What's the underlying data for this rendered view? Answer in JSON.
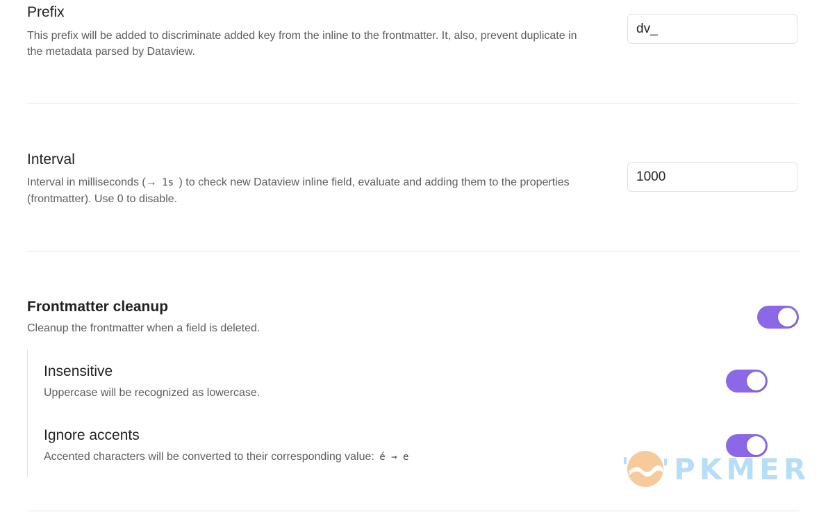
{
  "prefix": {
    "name": "Prefix",
    "description": "This prefix will be added to discriminate added key from the inline to the frontmatter. It, also, prevent duplicate in the metadata parsed by Dataview.",
    "value": "dv_"
  },
  "interval": {
    "name": "Interval",
    "description_before": "Interval in milliseconds (→",
    "description_code": "1s",
    "description_after": ") to check new Dataview inline field, evaluate and adding them to the properties (frontmatter). Use 0 to disable.",
    "value": "1000"
  },
  "frontmatter_cleanup": {
    "name": "Frontmatter cleanup",
    "description": "Cleanup the frontmatter when a field is deleted.",
    "enabled": true
  },
  "insensitive": {
    "name": "Insensitive",
    "description": "Uppercase will be recognized as lowercase.",
    "enabled": true
  },
  "ignore_accents": {
    "name": "Ignore accents",
    "description": "Accented characters will be converted to their corresponding value:",
    "example_code": "é → e",
    "enabled": true
  },
  "watermark": {
    "text": "PKMER",
    "icon": "pkmer-logo-icon"
  },
  "colors": {
    "accent": "#8b68e8",
    "divider": "#e6e6e6",
    "muted_text": "#5c5c5c"
  }
}
